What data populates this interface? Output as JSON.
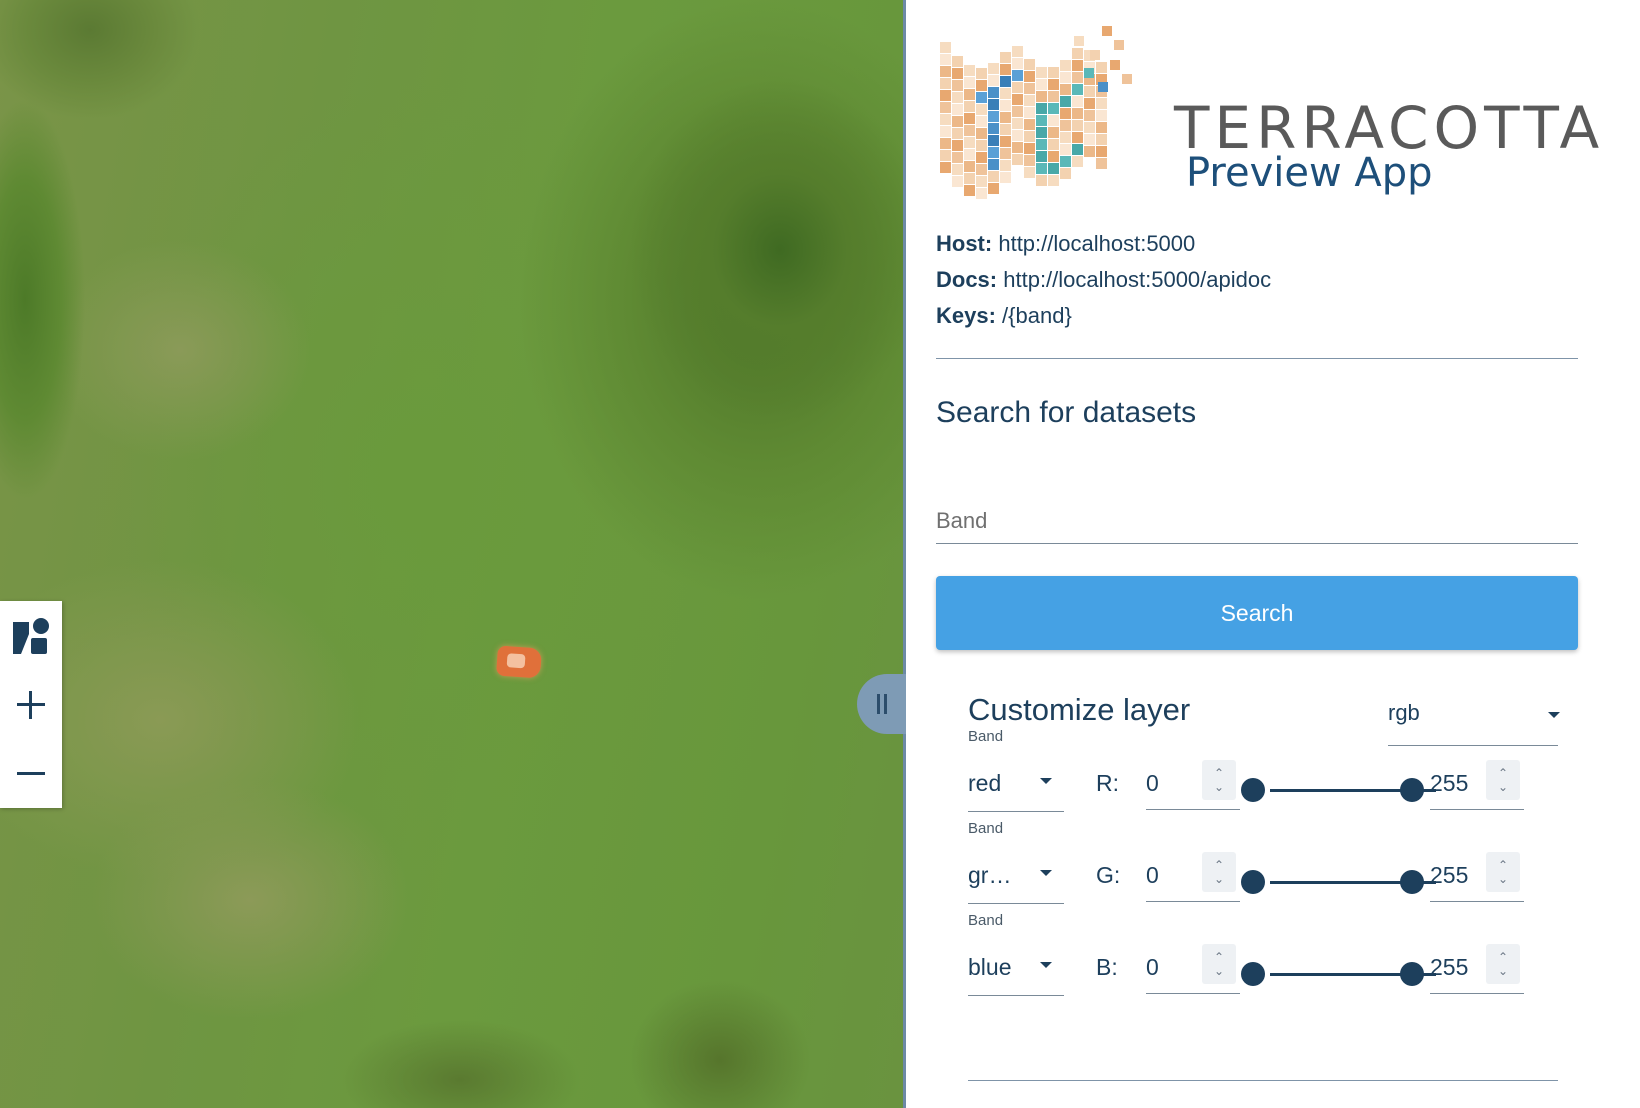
{
  "map": {
    "controls": [
      {
        "icon": "shapes-icon"
      },
      {
        "icon": "zoom-in-icon",
        "glyph": "+"
      },
      {
        "icon": "zoom-out-icon",
        "glyph": "−"
      }
    ]
  },
  "logo": {
    "title": "TERRACOTTA",
    "subtitle": "Preview App"
  },
  "info": {
    "host_label": "Host:",
    "host_value": "http://localhost:5000",
    "docs_label": "Docs:",
    "docs_value": "http://localhost:5000/apidoc",
    "keys_label": "Keys:",
    "keys_value": "/{band}"
  },
  "search": {
    "title": "Search for datasets",
    "placeholder": "Band",
    "button_label": "Search"
  },
  "customize": {
    "title": "Customize layer",
    "mode_value": "rgb",
    "rows": [
      {
        "band_label": "Band",
        "band_value": "red",
        "channel": "R:",
        "min": "0",
        "max": "255",
        "range_fraction": [
          0,
          1
        ]
      },
      {
        "band_label": "Band",
        "band_value": "gr…",
        "channel": "G:",
        "min": "0",
        "max": "255",
        "range_fraction": [
          0,
          1
        ]
      },
      {
        "band_label": "Band",
        "band_value": "blue",
        "channel": "B:",
        "min": "0",
        "max": "255",
        "range_fraction": [
          0,
          1
        ]
      }
    ]
  },
  "colors": {
    "accent": "#45a1e4",
    "text_primary": "#1d3f5c",
    "divider": "#6d8aa6"
  }
}
